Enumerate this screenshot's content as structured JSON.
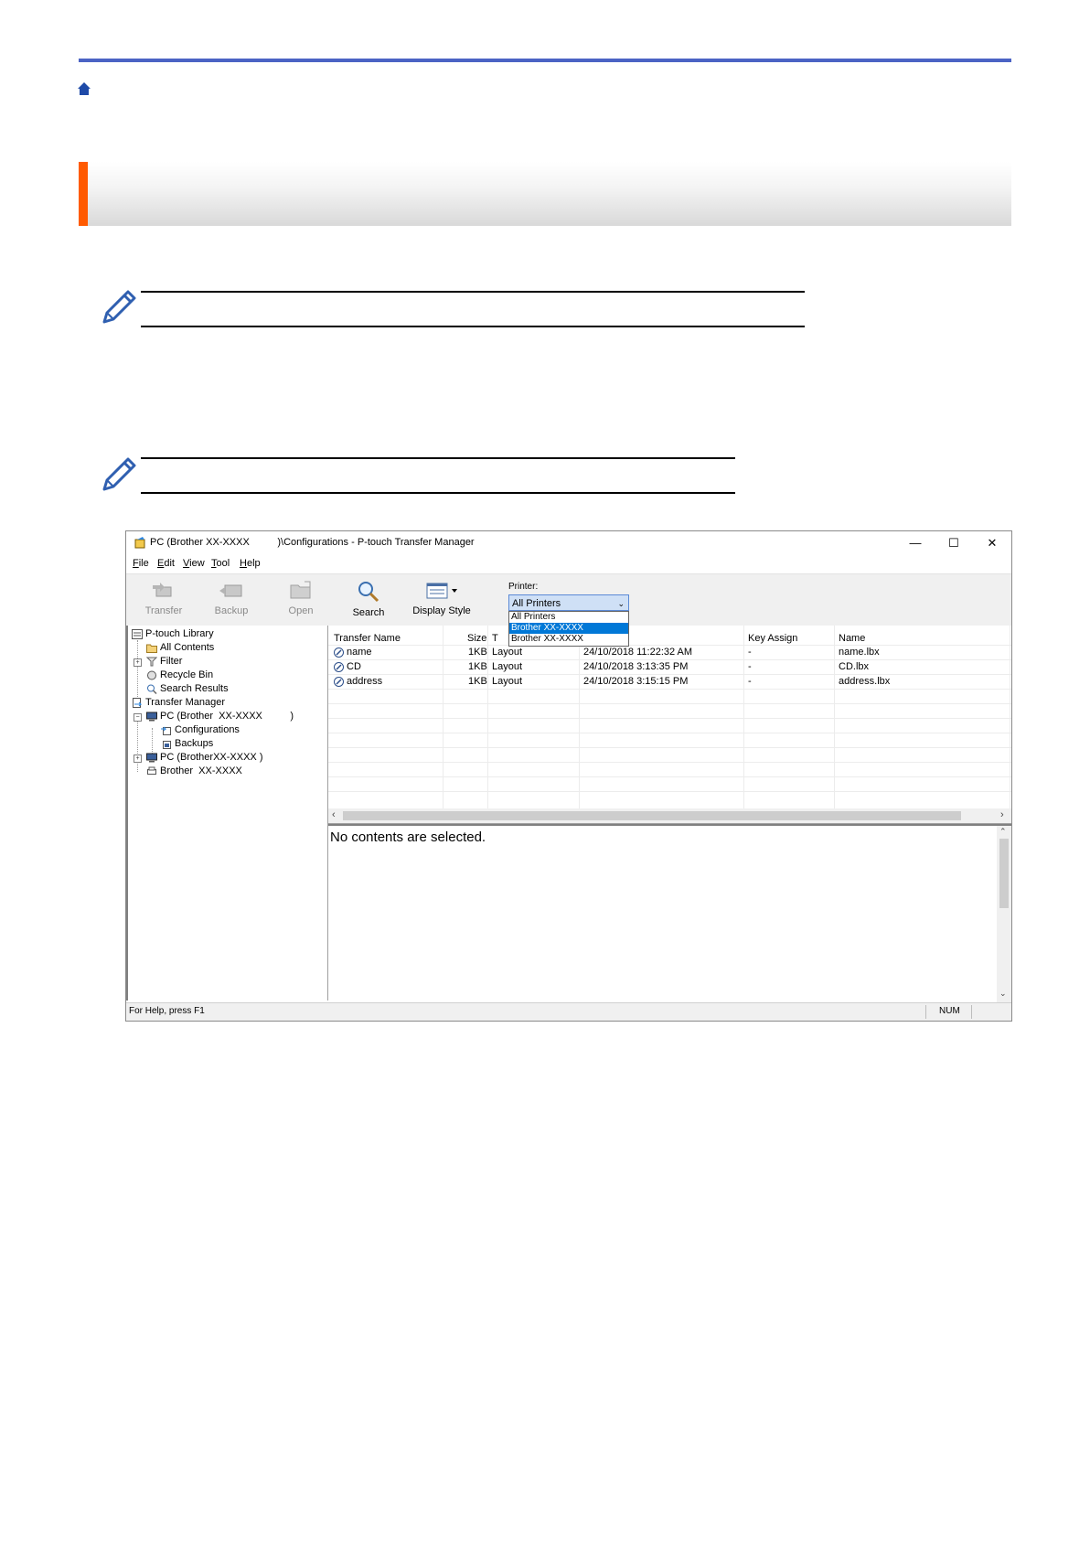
{
  "page": {
    "home_icon": "home-icon",
    "accent_color": "#ff5a00",
    "rule_color": "#4b63c4",
    "note_icon": "pencil-icon"
  },
  "window": {
    "title_left": "PC (Brother XX-XXXX",
    "title_right": ")\\Configurations - P-touch Transfer Manager",
    "controls": [
      "—",
      "☐",
      "✕"
    ],
    "menu": [
      {
        "key": "F",
        "rest": "ile"
      },
      {
        "key": "E",
        "rest": "dit"
      },
      {
        "key": "V",
        "rest": "iew"
      },
      {
        "key": "T",
        "rest": "ool"
      },
      {
        "key": "H",
        "rest": "elp"
      }
    ],
    "toolbar": {
      "transfer": "Transfer",
      "backup": "Backup",
      "open": "Open",
      "search": "Search",
      "display_style": "Display Style",
      "printer_label": "Printer:",
      "printer_selected": "All Printers",
      "printer_options": [
        "All Printers",
        "Brother  XX-XXXX",
        "Brother  XX-XXXX"
      ],
      "printer_highlighted_index": 1
    },
    "tree": {
      "library": "P-touch Library",
      "all_contents": "All Contents",
      "filter": "Filter",
      "recycle_bin": "Recycle Bin",
      "search_results": "Search Results",
      "transfer_manager": "Transfer Manager",
      "pc1": "PC (Brother  XX-XXXX          )",
      "configurations": "Configurations",
      "backups": "Backups",
      "pc2": "PC (BrotherXX-XXXX )",
      "brother": "Brother  XX-XXXX"
    },
    "list": {
      "columns": [
        "Transfer Name",
        "Size",
        "T",
        "Key Assign",
        "Name"
      ],
      "rows": [
        {
          "transfer_name": "name",
          "size": "1KB",
          "type": "Layout",
          "date": "24/10/2018 11:22:32 AM",
          "key": "-",
          "name": "name.lbx"
        },
        {
          "transfer_name": "CD",
          "size": "1KB",
          "type": "Layout",
          "date": "24/10/2018 3:13:35 PM",
          "key": "-",
          "name": "CD.lbx"
        },
        {
          "transfer_name": "address",
          "size": "1KB",
          "type": "Layout",
          "date": "24/10/2018 3:15:15 PM",
          "key": "-",
          "name": "address.lbx"
        }
      ]
    },
    "detail_message": "No contents are selected.",
    "status": {
      "help": "For Help, press F1",
      "num": "NUM"
    }
  }
}
